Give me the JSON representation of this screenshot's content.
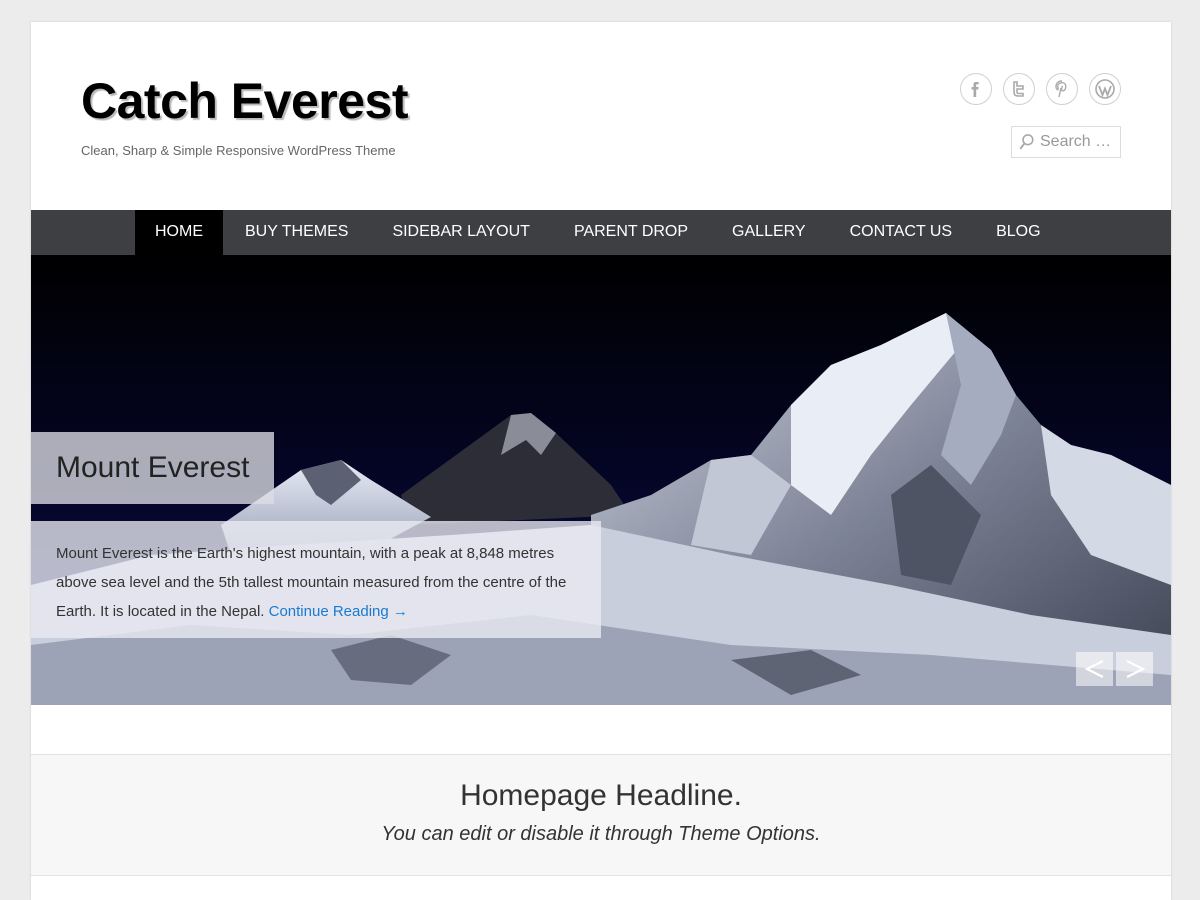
{
  "header": {
    "site_title": "Catch Everest",
    "site_description": "Clean, Sharp & Simple Responsive WordPress Theme",
    "search_placeholder": "Search …",
    "social_icons": [
      "facebook-icon",
      "twitter-icon",
      "pinterest-icon",
      "wordpress-icon"
    ]
  },
  "nav": {
    "items": [
      {
        "label": "HOME",
        "active": true
      },
      {
        "label": "BUY THEMES"
      },
      {
        "label": "SIDEBAR LAYOUT"
      },
      {
        "label": "PARENT DROP"
      },
      {
        "label": "GALLERY"
      },
      {
        "label": "CONTACT US"
      },
      {
        "label": "BLOG"
      }
    ]
  },
  "slider": {
    "title": "Mount Everest",
    "excerpt": "Mount Everest is the Earth's highest mountain, with a peak at 8,848 metres above sea level and the 5th tallest mountain measured from the centre of the Earth. It is located in the Nepal.",
    "read_more": "Continue Reading →",
    "prev_label": "<",
    "next_label": ">"
  },
  "headline": {
    "title": "Homepage Headline.",
    "subtitle": "You can edit or disable it through Theme Options."
  },
  "colors": {
    "nav_bg": "#3d3f43",
    "nav_active_bg": "#000000",
    "link": "#1a7ad1"
  }
}
